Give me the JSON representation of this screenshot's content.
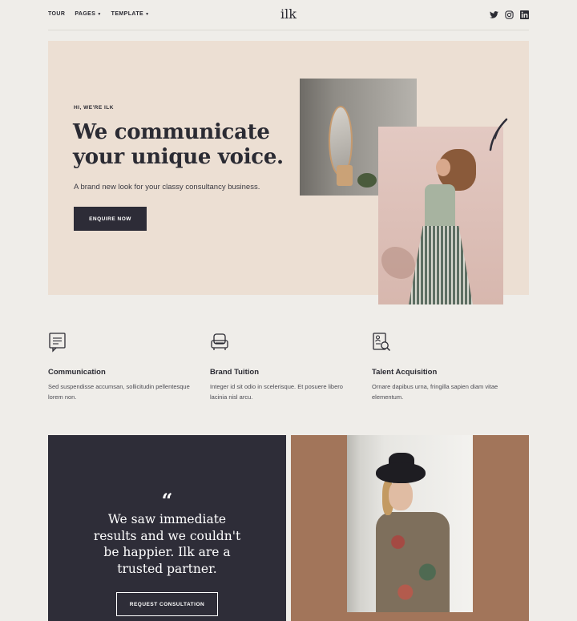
{
  "header": {
    "nav": [
      {
        "label": "TOUR",
        "caret": false
      },
      {
        "label": "PAGES",
        "caret": true
      },
      {
        "label": "TEMPLATE",
        "caret": true
      }
    ],
    "logo": "ilk",
    "social": [
      "twitter-icon",
      "instagram-icon",
      "linkedin-icon"
    ]
  },
  "hero": {
    "eyebrow": "HI, WE'RE ILK",
    "title": "We communicate your unique voice.",
    "subtitle": "A brand new look for your classy consultancy business.",
    "cta": "ENQUIRE NOW"
  },
  "features": [
    {
      "icon": "document-chat-icon",
      "title": "Communication",
      "text": "Sed suspendisse accumsan, sollicitudin pellentesque lorem non."
    },
    {
      "icon": "armchair-icon",
      "title": "Brand Tuition",
      "text": "Integer id sit odio in scelerisque. Et posuere libero lacinia nisl arcu."
    },
    {
      "icon": "resume-search-icon",
      "title": "Talent Acquisition",
      "text": "Ornare dapibus urna, fringilla sapien diam vitae elementum."
    }
  ],
  "testimonial": {
    "quote_mark": "“",
    "text": "We saw immediate results and we couldn't be happier. Ilk are a trusted partner.",
    "cta": "REQUEST CONSULTATION"
  },
  "colors": {
    "background": "#efede9",
    "hero_bg": "#ecdfd3",
    "dark": "#2e2d38",
    "brown": "#a2755a"
  }
}
